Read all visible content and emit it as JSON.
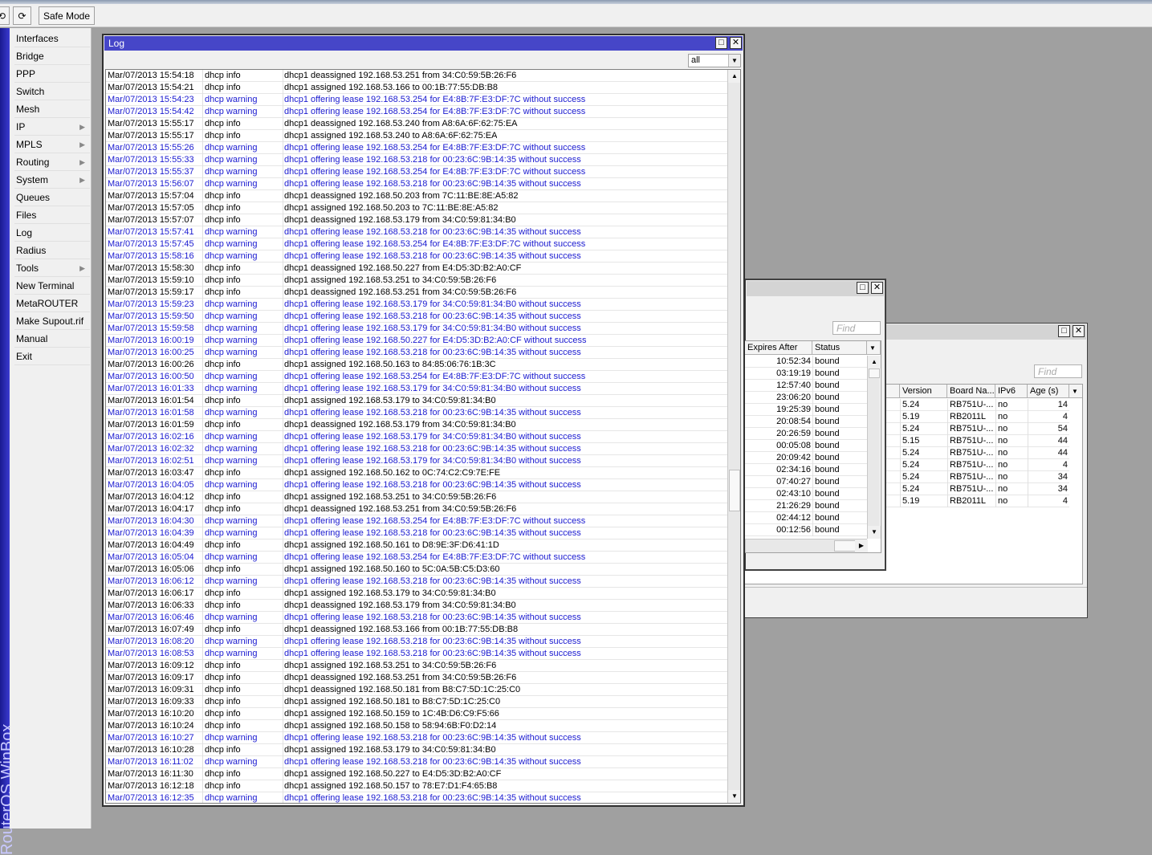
{
  "toolbar": {
    "undo_icon": "undo-icon",
    "redo_icon": "redo-icon",
    "safe_mode": "Safe Mode"
  },
  "brand": "RouterOS WinBox",
  "sidebar": {
    "items": [
      {
        "label": "Interfaces"
      },
      {
        "label": "Bridge"
      },
      {
        "label": "PPP"
      },
      {
        "label": "Switch"
      },
      {
        "label": "Mesh"
      },
      {
        "label": "IP",
        "submenu": true
      },
      {
        "label": "MPLS",
        "submenu": true
      },
      {
        "label": "Routing",
        "submenu": true
      },
      {
        "label": "System",
        "submenu": true
      },
      {
        "label": "Queues"
      },
      {
        "label": "Files"
      },
      {
        "label": "Log"
      },
      {
        "label": "Radius"
      },
      {
        "label": "Tools",
        "submenu": true
      },
      {
        "label": "New Terminal"
      },
      {
        "label": "MetaROUTER"
      },
      {
        "label": "Make Supout.rif"
      },
      {
        "label": "Manual"
      },
      {
        "label": "Exit"
      }
    ]
  },
  "colors": {
    "title_active": "#4646c8",
    "warning_text": "#1a1ad0",
    "desktop": "#a0a0a0"
  },
  "log": {
    "title": "Log",
    "filter": "all",
    "rows": [
      [
        "Mar/07/2013 15:54:18",
        "dhcp info",
        "dhcp1 deassigned 192.168.53.251 from 34:C0:59:5B:26:F6"
      ],
      [
        "Mar/07/2013 15:54:21",
        "dhcp info",
        "dhcp1 assigned 192.168.53.166 to 00:1B:77:55:DB:B8"
      ],
      [
        "Mar/07/2013 15:54:23",
        "dhcp warning",
        "dhcp1 offering lease 192.168.53.254 for E4:8B:7F:E3:DF:7C without success"
      ],
      [
        "Mar/07/2013 15:54:42",
        "dhcp warning",
        "dhcp1 offering lease 192.168.53.254 for E4:8B:7F:E3:DF:7C without success"
      ],
      [
        "Mar/07/2013 15:55:17",
        "dhcp info",
        "dhcp1 deassigned 192.168.53.240 from A8:6A:6F:62:75:EA"
      ],
      [
        "Mar/07/2013 15:55:17",
        "dhcp info",
        "dhcp1 assigned 192.168.53.240 to A8:6A:6F:62:75:EA"
      ],
      [
        "Mar/07/2013 15:55:26",
        "dhcp warning",
        "dhcp1 offering lease 192.168.53.254 for E4:8B:7F:E3:DF:7C without success"
      ],
      [
        "Mar/07/2013 15:55:33",
        "dhcp warning",
        "dhcp1 offering lease 192.168.53.218 for 00:23:6C:9B:14:35 without success"
      ],
      [
        "Mar/07/2013 15:55:37",
        "dhcp warning",
        "dhcp1 offering lease 192.168.53.254 for E4:8B:7F:E3:DF:7C without success"
      ],
      [
        "Mar/07/2013 15:56:07",
        "dhcp warning",
        "dhcp1 offering lease 192.168.53.218 for 00:23:6C:9B:14:35 without success"
      ],
      [
        "Mar/07/2013 15:57:04",
        "dhcp info",
        "dhcp1 deassigned 192.168.50.203 from 7C:11:BE:8E:A5:82"
      ],
      [
        "Mar/07/2013 15:57:05",
        "dhcp info",
        "dhcp1 assigned 192.168.50.203 to 7C:11:BE:8E:A5:82"
      ],
      [
        "Mar/07/2013 15:57:07",
        "dhcp info",
        "dhcp1 deassigned 192.168.53.179 from 34:C0:59:81:34:B0"
      ],
      [
        "Mar/07/2013 15:57:41",
        "dhcp warning",
        "dhcp1 offering lease 192.168.53.218 for 00:23:6C:9B:14:35 without success"
      ],
      [
        "Mar/07/2013 15:57:45",
        "dhcp warning",
        "dhcp1 offering lease 192.168.53.254 for E4:8B:7F:E3:DF:7C without success"
      ],
      [
        "Mar/07/2013 15:58:16",
        "dhcp warning",
        "dhcp1 offering lease 192.168.53.218 for 00:23:6C:9B:14:35 without success"
      ],
      [
        "Mar/07/2013 15:58:30",
        "dhcp info",
        "dhcp1 deassigned 192.168.50.227 from E4:D5:3D:B2:A0:CF"
      ],
      [
        "Mar/07/2013 15:59:10",
        "dhcp info",
        "dhcp1 assigned 192.168.53.251 to 34:C0:59:5B:26:F6"
      ],
      [
        "Mar/07/2013 15:59:17",
        "dhcp info",
        "dhcp1 deassigned 192.168.53.251 from 34:C0:59:5B:26:F6"
      ],
      [
        "Mar/07/2013 15:59:23",
        "dhcp warning",
        "dhcp1 offering lease 192.168.53.179 for 34:C0:59:81:34:B0 without success"
      ],
      [
        "Mar/07/2013 15:59:50",
        "dhcp warning",
        "dhcp1 offering lease 192.168.53.218 for 00:23:6C:9B:14:35 without success"
      ],
      [
        "Mar/07/2013 15:59:58",
        "dhcp warning",
        "dhcp1 offering lease 192.168.53.179 for 34:C0:59:81:34:B0 without success"
      ],
      [
        "Mar/07/2013 16:00:19",
        "dhcp warning",
        "dhcp1 offering lease 192.168.50.227 for E4:D5:3D:B2:A0:CF without success"
      ],
      [
        "Mar/07/2013 16:00:25",
        "dhcp warning",
        "dhcp1 offering lease 192.168.53.218 for 00:23:6C:9B:14:35 without success"
      ],
      [
        "Mar/07/2013 16:00:26",
        "dhcp info",
        "dhcp1 assigned 192.168.50.163 to 84:85:06:76:1B:3C"
      ],
      [
        "Mar/07/2013 16:00:50",
        "dhcp warning",
        "dhcp1 offering lease 192.168.53.254 for E4:8B:7F:E3:DF:7C without success"
      ],
      [
        "Mar/07/2013 16:01:33",
        "dhcp warning",
        "dhcp1 offering lease 192.168.53.179 for 34:C0:59:81:34:B0 without success"
      ],
      [
        "Mar/07/2013 16:01:54",
        "dhcp info",
        "dhcp1 assigned 192.168.53.179 to 34:C0:59:81:34:B0"
      ],
      [
        "Mar/07/2013 16:01:58",
        "dhcp warning",
        "dhcp1 offering lease 192.168.53.218 for 00:23:6C:9B:14:35 without success"
      ],
      [
        "Mar/07/2013 16:01:59",
        "dhcp info",
        "dhcp1 deassigned 192.168.53.179 from 34:C0:59:81:34:B0"
      ],
      [
        "Mar/07/2013 16:02:16",
        "dhcp warning",
        "dhcp1 offering lease 192.168.53.179 for 34:C0:59:81:34:B0 without success"
      ],
      [
        "Mar/07/2013 16:02:32",
        "dhcp warning",
        "dhcp1 offering lease 192.168.53.218 for 00:23:6C:9B:14:35 without success"
      ],
      [
        "Mar/07/2013 16:02:51",
        "dhcp warning",
        "dhcp1 offering lease 192.168.53.179 for 34:C0:59:81:34:B0 without success"
      ],
      [
        "Mar/07/2013 16:03:47",
        "dhcp info",
        "dhcp1 assigned 192.168.50.162 to 0C:74:C2:C9:7E:FE"
      ],
      [
        "Mar/07/2013 16:04:05",
        "dhcp warning",
        "dhcp1 offering lease 192.168.53.218 for 00:23:6C:9B:14:35 without success"
      ],
      [
        "Mar/07/2013 16:04:12",
        "dhcp info",
        "dhcp1 assigned 192.168.53.251 to 34:C0:59:5B:26:F6"
      ],
      [
        "Mar/07/2013 16:04:17",
        "dhcp info",
        "dhcp1 deassigned 192.168.53.251 from 34:C0:59:5B:26:F6"
      ],
      [
        "Mar/07/2013 16:04:30",
        "dhcp warning",
        "dhcp1 offering lease 192.168.53.254 for E4:8B:7F:E3:DF:7C without success"
      ],
      [
        "Mar/07/2013 16:04:39",
        "dhcp warning",
        "dhcp1 offering lease 192.168.53.218 for 00:23:6C:9B:14:35 without success"
      ],
      [
        "Mar/07/2013 16:04:49",
        "dhcp info",
        "dhcp1 assigned 192.168.50.161 to D8:9E:3F:D6:41:1D"
      ],
      [
        "Mar/07/2013 16:05:04",
        "dhcp warning",
        "dhcp1 offering lease 192.168.53.254 for E4:8B:7F:E3:DF:7C without success"
      ],
      [
        "Mar/07/2013 16:05:06",
        "dhcp info",
        "dhcp1 assigned 192.168.50.160 to 5C:0A:5B:C5:D3:60"
      ],
      [
        "Mar/07/2013 16:06:12",
        "dhcp warning",
        "dhcp1 offering lease 192.168.53.218 for 00:23:6C:9B:14:35 without success"
      ],
      [
        "Mar/07/2013 16:06:17",
        "dhcp info",
        "dhcp1 assigned 192.168.53.179 to 34:C0:59:81:34:B0"
      ],
      [
        "Mar/07/2013 16:06:33",
        "dhcp info",
        "dhcp1 deassigned 192.168.53.179 from 34:C0:59:81:34:B0"
      ],
      [
        "Mar/07/2013 16:06:46",
        "dhcp warning",
        "dhcp1 offering lease 192.168.53.218 for 00:23:6C:9B:14:35 without success"
      ],
      [
        "Mar/07/2013 16:07:49",
        "dhcp info",
        "dhcp1 deassigned 192.168.53.166 from 00:1B:77:55:DB:B8"
      ],
      [
        "Mar/07/2013 16:08:20",
        "dhcp warning",
        "dhcp1 offering lease 192.168.53.218 for 00:23:6C:9B:14:35 without success"
      ],
      [
        "Mar/07/2013 16:08:53",
        "dhcp warning",
        "dhcp1 offering lease 192.168.53.218 for 00:23:6C:9B:14:35 without success"
      ],
      [
        "Mar/07/2013 16:09:12",
        "dhcp info",
        "dhcp1 assigned 192.168.53.251 to 34:C0:59:5B:26:F6"
      ],
      [
        "Mar/07/2013 16:09:17",
        "dhcp info",
        "dhcp1 deassigned 192.168.53.251 from 34:C0:59:5B:26:F6"
      ],
      [
        "Mar/07/2013 16:09:31",
        "dhcp info",
        "dhcp1 deassigned 192.168.50.181 from B8:C7:5D:1C:25:C0"
      ],
      [
        "Mar/07/2013 16:09:33",
        "dhcp info",
        "dhcp1 assigned 192.168.50.181 to B8:C7:5D:1C:25:C0"
      ],
      [
        "Mar/07/2013 16:10:20",
        "dhcp info",
        "dhcp1 assigned 192.168.50.159 to 1C:4B:D6:C9:F5:66"
      ],
      [
        "Mar/07/2013 16:10:24",
        "dhcp info",
        "dhcp1 assigned 192.168.50.158 to 58:94:6B:F0:D2:14"
      ],
      [
        "Mar/07/2013 16:10:27",
        "dhcp warning",
        "dhcp1 offering lease 192.168.53.218 for 00:23:6C:9B:14:35 without success"
      ],
      [
        "Mar/07/2013 16:10:28",
        "dhcp info",
        "dhcp1 assigned 192.168.53.179 to 34:C0:59:81:34:B0"
      ],
      [
        "Mar/07/2013 16:11:02",
        "dhcp warning",
        "dhcp1 offering lease 192.168.53.218 for 00:23:6C:9B:14:35 without success"
      ],
      [
        "Mar/07/2013 16:11:30",
        "dhcp info",
        "dhcp1 assigned 192.168.50.227 to E4:D5:3D:B2:A0:CF"
      ],
      [
        "Mar/07/2013 16:12:18",
        "dhcp info",
        "dhcp1 assigned 192.168.50.157 to 78:E7:D1:F4:65:B8"
      ],
      [
        "Mar/07/2013 16:12:35",
        "dhcp warning",
        "dhcp1 offering lease 192.168.53.218 for 00:23:6C:9B:14:35 without success"
      ]
    ]
  },
  "leases": {
    "find_placeholder": "Find",
    "columns": [
      "Expires After",
      "Status"
    ],
    "rows": [
      [
        "10:52:34",
        "bound"
      ],
      [
        "03:19:19",
        "bound"
      ],
      [
        "12:57:40",
        "bound"
      ],
      [
        "23:06:20",
        "bound"
      ],
      [
        "19:25:39",
        "bound"
      ],
      [
        "20:08:54",
        "bound"
      ],
      [
        "20:26:59",
        "bound"
      ],
      [
        "00:05:08",
        "bound"
      ],
      [
        "20:09:42",
        "bound"
      ],
      [
        "02:34:16",
        "bound"
      ],
      [
        "07:40:27",
        "bound"
      ],
      [
        "02:43:10",
        "bound"
      ],
      [
        "21:26:29",
        "bound"
      ],
      [
        "02:44:12",
        "bound"
      ],
      [
        "00:12:56",
        "bound"
      ]
    ]
  },
  "neighbors": {
    "find_placeholder": "Find",
    "columns": [
      "Version",
      "Board Na...",
      "IPv6",
      "Age (s)"
    ],
    "rows": [
      [
        "5.24",
        "RB751U-...",
        "no",
        "14"
      ],
      [
        "5.19",
        "RB2011L",
        "no",
        "4"
      ],
      [
        "5.24",
        "RB751U-...",
        "no",
        "54"
      ],
      [
        "5.15",
        "RB751U-...",
        "no",
        "44"
      ],
      [
        "5.24",
        "RB751U-...",
        "no",
        "44"
      ],
      [
        "5.24",
        "RB751U-...",
        "no",
        "4"
      ],
      [
        "5.24",
        "RB751U-...",
        "no",
        "34"
      ],
      [
        "5.24",
        "RB751U-...",
        "no",
        "34"
      ],
      [
        "5.19",
        "RB2011L",
        "no",
        "4"
      ]
    ]
  }
}
